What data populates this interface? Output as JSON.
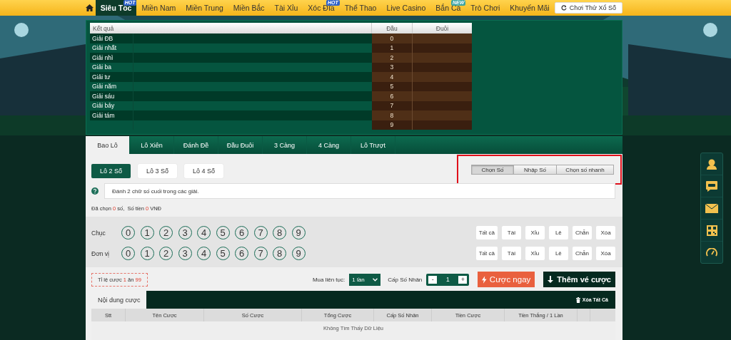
{
  "nav": {
    "items": [
      {
        "label": "Siêu Tốc",
        "selected": true,
        "badge": "HOT"
      },
      {
        "label": "Miền Nam",
        "selected": false
      },
      {
        "label": "Miền Trung",
        "selected": false
      },
      {
        "label": "Miền Bắc",
        "selected": false
      },
      {
        "label": "Tài Xỉu",
        "selected": false
      },
      {
        "label": "Xóc Đĩa",
        "selected": false,
        "badge": "HOT"
      },
      {
        "label": "Thể Thao",
        "selected": false
      },
      {
        "label": "Live Casino",
        "selected": false
      },
      {
        "label": "Bắn Cá",
        "selected": false,
        "badge": "NEW"
      },
      {
        "label": "Trò Chơi",
        "selected": false
      },
      {
        "label": "Khuyến Mãi",
        "selected": false
      }
    ],
    "try_button": "Chơi Thử Xổ Số"
  },
  "results": {
    "columns": [
      "Kết quả",
      "Đầu",
      "Đuôi"
    ],
    "rows": [
      {
        "prize": "Giải ĐB",
        "head": "0"
      },
      {
        "prize": "Giải nhất",
        "head": "1"
      },
      {
        "prize": "Giải nhì",
        "head": "2"
      },
      {
        "prize": "Giải ba",
        "head": "3"
      },
      {
        "prize": "Giải tư",
        "head": "4"
      },
      {
        "prize": "Giải năm",
        "head": "5"
      },
      {
        "prize": "Giải sáu",
        "head": "6"
      },
      {
        "prize": "Giải bảy",
        "head": "7"
      },
      {
        "prize": "Giải tám",
        "head": "8"
      },
      {
        "prize": "",
        "head": "9"
      }
    ]
  },
  "tabs": [
    {
      "label": "Bao Lô",
      "selected": true
    },
    {
      "label": "Lô Xiên",
      "selected": false
    },
    {
      "label": "Đánh Đề",
      "selected": false
    },
    {
      "label": "Đầu Đuôi",
      "selected": false
    },
    {
      "label": "3 Càng",
      "selected": false
    },
    {
      "label": "4 Càng",
      "selected": false
    },
    {
      "label": "Lô Trượt",
      "selected": false
    }
  ],
  "sub_tabs": [
    {
      "label": "Lô 2 Số",
      "selected": true
    },
    {
      "label": "Lô 3 Số",
      "selected": false
    },
    {
      "label": "Lô 4 Số",
      "selected": false
    }
  ],
  "modes": [
    {
      "label": "Chọn Số",
      "selected": true
    },
    {
      "label": "Nhập Số",
      "selected": false
    },
    {
      "label": "Chọn số nhanh",
      "selected": false
    }
  ],
  "hint": "Đánh 2 chữ số cuối trong các giải.",
  "summary": {
    "selected_label": "Đã chọn",
    "count": "0",
    "unit": "số,",
    "amount_label": "Số tiền",
    "amount": "0",
    "currency": "VNĐ"
  },
  "digit_rows": [
    {
      "label": "Chục",
      "digits": [
        "0",
        "1",
        "2",
        "3",
        "4",
        "5",
        "6",
        "7",
        "8",
        "9"
      ],
      "actions": [
        "Tất cả",
        "Tài",
        "Xỉu",
        "Lẻ",
        "Chẵn",
        "Xóa"
      ]
    },
    {
      "label": "Đơn vị",
      "digits": [
        "0",
        "1",
        "2",
        "3",
        "4",
        "5",
        "6",
        "7",
        "8",
        "9"
      ],
      "actions": [
        "Tất cả",
        "Tài",
        "Xỉu",
        "Lẻ",
        "Chẵn",
        "Xóa"
      ]
    }
  ],
  "odds": {
    "label": "Tỉ lệ cược",
    "stake": "1",
    "word": "ăn",
    "payout": "99"
  },
  "repeat": {
    "label": "Mua liên tục:",
    "value": "1 lần"
  },
  "multiplier": {
    "label": "Cấp Số Nhân",
    "minus": "-",
    "value": "1",
    "plus": "+"
  },
  "bet_now": "Cược ngay",
  "add_ticket": "Thêm vé cược",
  "bets": {
    "tab": "Nội dung cược",
    "clear": "Xóa Tất Cả",
    "columns": [
      "Stt",
      "Tên Cược",
      "Số Cược",
      "Tổng Cược",
      "Cấp Số Nhân",
      "Tiền Cược",
      "Tiền Thắng / 1 Lần"
    ],
    "empty": "Không Tìm Thấy Dữ Liệu"
  }
}
